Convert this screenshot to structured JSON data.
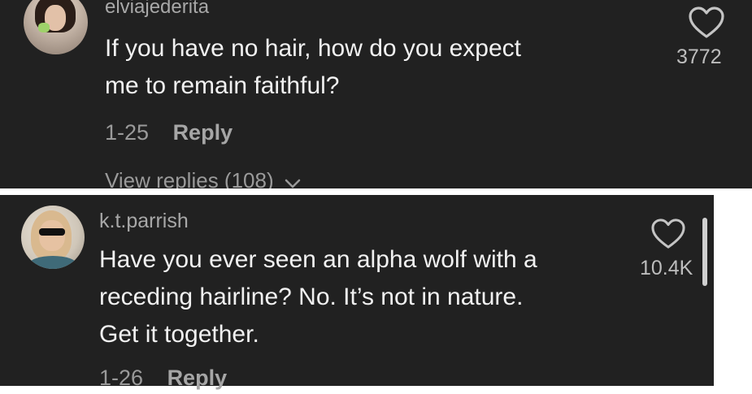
{
  "comments": [
    {
      "username": "elviajederita",
      "text_lines": [
        "If you have no hair, how do you expect",
        "me to remain faithful?"
      ],
      "date": "1-25",
      "reply_label": "Reply",
      "likes": "3772",
      "view_replies": "View replies (108)"
    },
    {
      "username": "k.t.parrish",
      "text_lines": [
        "Have you ever seen an alpha wolf with a",
        "receding hairline? No. It’s not in nature.",
        "Get it together."
      ],
      "date": "1-26",
      "reply_label": "Reply",
      "likes": "10.4K"
    }
  ],
  "icons": {
    "like": "heart-outline-icon",
    "expand": "chevron-down-icon"
  },
  "colors": {
    "panel_bg": "#212121",
    "text_primary": "#f1f1f1",
    "text_secondary": "#a8a8a8"
  }
}
